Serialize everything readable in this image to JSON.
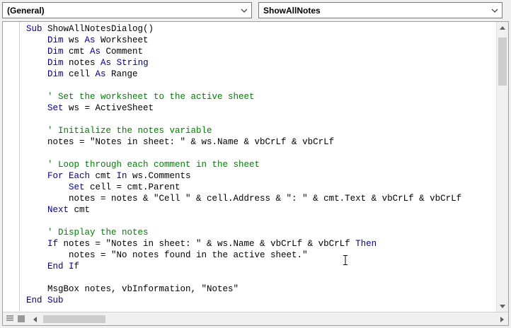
{
  "dropdowns": {
    "object": "(General)",
    "procedure": "ShowAllNotes"
  },
  "code_lines": [
    [
      {
        "t": "Sub",
        "c": "kw"
      },
      {
        "t": " ShowAllNotesDialog()",
        "c": ""
      }
    ],
    [
      {
        "t": "    Dim",
        "c": "kw"
      },
      {
        "t": " ws ",
        "c": ""
      },
      {
        "t": "As",
        "c": "kw"
      },
      {
        "t": " Worksheet",
        "c": ""
      }
    ],
    [
      {
        "t": "    Dim",
        "c": "kw"
      },
      {
        "t": " cmt ",
        "c": ""
      },
      {
        "t": "As",
        "c": "kw"
      },
      {
        "t": " Comment",
        "c": ""
      }
    ],
    [
      {
        "t": "    Dim",
        "c": "kw"
      },
      {
        "t": " notes ",
        "c": ""
      },
      {
        "t": "As",
        "c": "kw"
      },
      {
        "t": " ",
        "c": ""
      },
      {
        "t": "String",
        "c": "kw"
      }
    ],
    [
      {
        "t": "    Dim",
        "c": "kw"
      },
      {
        "t": " cell ",
        "c": ""
      },
      {
        "t": "As",
        "c": "kw"
      },
      {
        "t": " Range",
        "c": ""
      }
    ],
    [
      {
        "t": "",
        "c": ""
      }
    ],
    [
      {
        "t": "    ' Set the worksheet to the active sheet",
        "c": "cm"
      }
    ],
    [
      {
        "t": "    Set",
        "c": "kw"
      },
      {
        "t": " ws = ActiveSheet",
        "c": ""
      }
    ],
    [
      {
        "t": "",
        "c": ""
      }
    ],
    [
      {
        "t": "    ' Initialize the notes variable",
        "c": "cm"
      }
    ],
    [
      {
        "t": "    notes = \"Notes in sheet: \" & ws.Name & vbCrLf & vbCrLf",
        "c": ""
      }
    ],
    [
      {
        "t": "",
        "c": ""
      }
    ],
    [
      {
        "t": "    ' Loop through each comment in the sheet",
        "c": "cm"
      }
    ],
    [
      {
        "t": "    For Each",
        "c": "kw"
      },
      {
        "t": " cmt ",
        "c": ""
      },
      {
        "t": "In",
        "c": "kw"
      },
      {
        "t": " ws.Comments",
        "c": ""
      }
    ],
    [
      {
        "t": "        Set",
        "c": "kw"
      },
      {
        "t": " cell = cmt.Parent",
        "c": ""
      }
    ],
    [
      {
        "t": "        notes = notes & \"Cell \" & cell.Address & \": \" & cmt.Text & vbCrLf & vbCrLf",
        "c": ""
      }
    ],
    [
      {
        "t": "    Next",
        "c": "kw"
      },
      {
        "t": " cmt",
        "c": ""
      }
    ],
    [
      {
        "t": "",
        "c": ""
      }
    ],
    [
      {
        "t": "    ' Display the notes",
        "c": "cm"
      }
    ],
    [
      {
        "t": "    If",
        "c": "kw"
      },
      {
        "t": " notes = \"Notes in sheet: \" & ws.Name & vbCrLf & vbCrLf ",
        "c": ""
      },
      {
        "t": "Then",
        "c": "kw"
      }
    ],
    [
      {
        "t": "        notes = \"No notes found in the active sheet.\"",
        "c": ""
      }
    ],
    [
      {
        "t": "    End If",
        "c": "kw"
      }
    ],
    [
      {
        "t": "",
        "c": ""
      }
    ],
    [
      {
        "t": "    MsgBox notes, vbInformation, \"Notes\"",
        "c": ""
      }
    ],
    [
      {
        "t": "End Sub",
        "c": "kw"
      }
    ]
  ],
  "colors": {
    "keyword": "#00008b",
    "comment": "#008000",
    "text": "#000000"
  },
  "icons": {
    "dropdown_arrow": "chevron-down-icon",
    "scroll_up": "scroll-up-arrow-icon",
    "scroll_down": "scroll-down-arrow-icon",
    "scroll_left": "scroll-left-arrow-icon",
    "scroll_right": "scroll-right-arrow-icon",
    "procedure_view": "procedure-view-icon",
    "full_module_view": "full-module-view-icon"
  }
}
